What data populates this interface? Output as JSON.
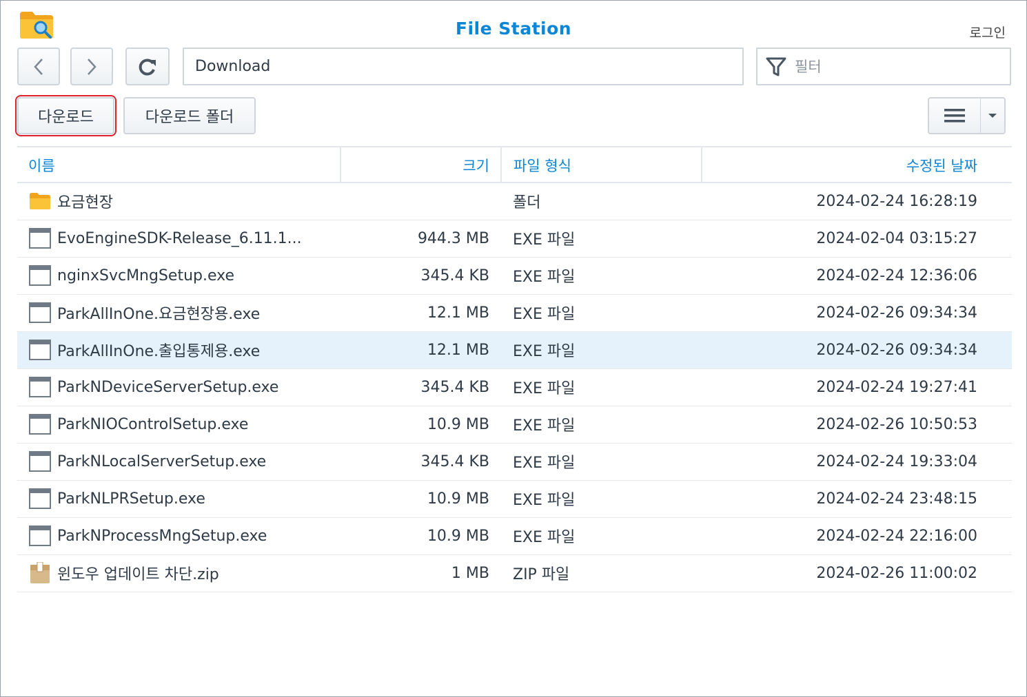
{
  "app": {
    "title": "File Station",
    "login_label": "로그인"
  },
  "path": {
    "value": "Download"
  },
  "filter": {
    "placeholder": "필터"
  },
  "toolbar": {
    "download_label": "다운로드",
    "download_folder_label": "다운로드 폴더"
  },
  "table": {
    "headers": {
      "name": "이름",
      "size": "크기",
      "type": "파일 형식",
      "modified": "수정된 날짜"
    },
    "rows": [
      {
        "icon": "folder-icon",
        "name": "요금현장",
        "size": "",
        "type": "폴더",
        "modified": "2024-02-24 16:28:19"
      },
      {
        "icon": "exe-file-icon",
        "name": "EvoEngineSDK-Release_6.11.1...",
        "size": "944.3 MB",
        "type": "EXE 파일",
        "modified": "2024-02-04 03:15:27"
      },
      {
        "icon": "exe-file-icon",
        "name": "nginxSvcMngSetup.exe",
        "size": "345.4 KB",
        "type": "EXE 파일",
        "modified": "2024-02-24 12:36:06"
      },
      {
        "icon": "exe-file-icon",
        "name": "ParkAllInOne.요금현장용.exe",
        "size": "12.1 MB",
        "type": "EXE 파일",
        "modified": "2024-02-26 09:34:34"
      },
      {
        "icon": "exe-file-icon",
        "name": "ParkAllInOne.출입통제용.exe",
        "size": "12.1 MB",
        "type": "EXE 파일",
        "modified": "2024-02-26 09:34:34",
        "selected": true
      },
      {
        "icon": "exe-file-icon",
        "name": "ParkNDeviceServerSetup.exe",
        "size": "345.4 KB",
        "type": "EXE 파일",
        "modified": "2024-02-24 19:27:41"
      },
      {
        "icon": "exe-file-icon",
        "name": "ParkNIOControlSetup.exe",
        "size": "10.9 MB",
        "type": "EXE 파일",
        "modified": "2024-02-26 10:50:53"
      },
      {
        "icon": "exe-file-icon",
        "name": "ParkNLocalServerSetup.exe",
        "size": "345.4 KB",
        "type": "EXE 파일",
        "modified": "2024-02-24 19:33:04"
      },
      {
        "icon": "exe-file-icon",
        "name": "ParkNLPRSetup.exe",
        "size": "10.9 MB",
        "type": "EXE 파일",
        "modified": "2024-02-24 23:48:15"
      },
      {
        "icon": "exe-file-icon",
        "name": "ParkNProcessMngSetup.exe",
        "size": "10.9 MB",
        "type": "EXE 파일",
        "modified": "2024-02-24 22:16:00"
      },
      {
        "icon": "zip-file-icon",
        "name": "윈도우 업데이트 차단.zip",
        "size": "1 MB",
        "type": "ZIP 파일",
        "modified": "2024-02-26 11:00:02"
      }
    ]
  },
  "colors": {
    "accent": "#0b86d6",
    "selected_row": "#e6f2fb",
    "highlight": "#e0202a"
  }
}
